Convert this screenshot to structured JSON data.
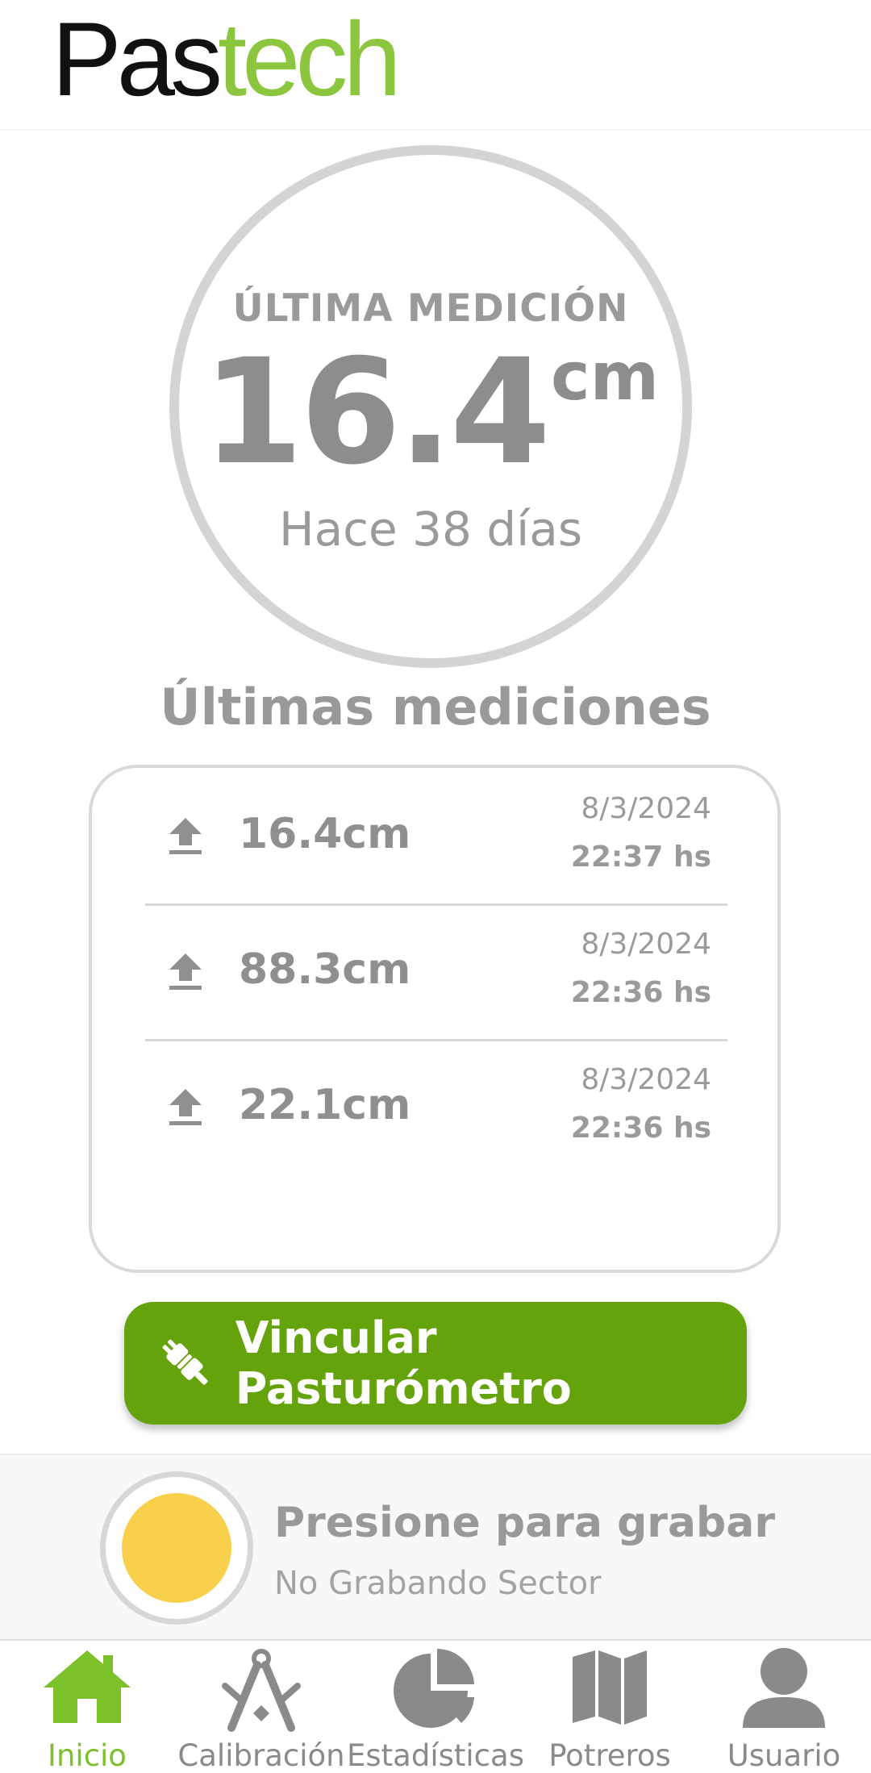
{
  "brand": {
    "part1": "Pas",
    "part2": "tech",
    "colors": {
      "dark": "#111111",
      "green": "#8cc63f"
    }
  },
  "last_measurement": {
    "label": "ÚLTIMA MEDICIÓN",
    "value": "16.4",
    "unit": "cm",
    "ago": "Hace 38 días"
  },
  "recent": {
    "title": "Últimas mediciones",
    "rows": [
      {
        "icon": "upload-icon",
        "value": "16.4cm",
        "date": "8/3/2024",
        "time": "22:37 hs"
      },
      {
        "icon": "upload-icon",
        "value": "88.3cm",
        "date": "8/3/2024",
        "time": "22:36 hs"
      },
      {
        "icon": "upload-icon",
        "value": "22.1cm",
        "date": "8/3/2024",
        "time": "22:36 hs"
      }
    ]
  },
  "link_button": {
    "label": "Vincular Pasturómetro",
    "icon": "plug-icon",
    "color": "#65a30d"
  },
  "recorder": {
    "title": "Presione para grabar",
    "status": "No Grabando Sector",
    "indicator_color": "#f9d04b"
  },
  "nav": {
    "active": "inicio",
    "active_color": "#7cc02a",
    "items": [
      {
        "id": "inicio",
        "label": "Inicio",
        "icon": "home-icon"
      },
      {
        "id": "calibracion",
        "label": "Calibración",
        "icon": "compass-icon"
      },
      {
        "id": "estadisticas",
        "label": "Estadísticas",
        "icon": "pie-chart-icon"
      },
      {
        "id": "potreros",
        "label": "Potreros",
        "icon": "map-icon"
      },
      {
        "id": "usuario",
        "label": "Usuario",
        "icon": "user-icon"
      }
    ]
  }
}
